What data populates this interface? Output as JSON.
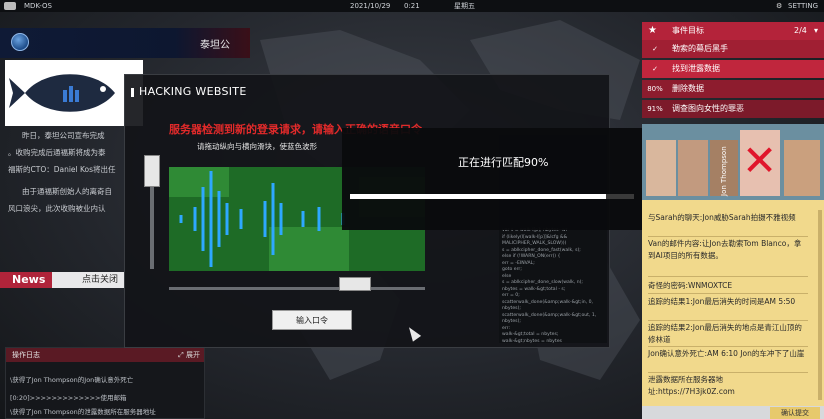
{
  "topbar": {
    "app": "MDK-OS",
    "date": "2021/10/29",
    "time": "0:21",
    "weekday": "星期五",
    "setting": "SETTING"
  },
  "news": {
    "title": "泰坦公",
    "paragraphs": [
      "昨日，泰坦公司宣布完成",
      "。收购完成后通福斯将成为泰",
      "福斯的CTO：Daniel Kos将出任",
      "由于通福斯创始人的离奇自",
      "风口浪尖，此次收购被业内认"
    ],
    "tag": "News",
    "tag2": "点击关闭"
  },
  "log": {
    "title": "操作日志",
    "expand": "展开",
    "lines": [
      "\\获得了Jon Thompson的Jon确认意外死亡",
      "[0:20]>>>>>>>>>>>>>使用邮箱",
      "\\获得了Jon Thompson的泄露数据所在服务器地址"
    ]
  },
  "objectives": {
    "title": "事件目标",
    "count": "2/4",
    "items": [
      {
        "mark": "✓",
        "label": "勒索的幕后黑手"
      },
      {
        "mark": "✓",
        "label": "找到泄露数据"
      },
      {
        "mark": "80%",
        "label": "删除数据"
      },
      {
        "mark": "91%",
        "label": "调查图向女性的罪恶"
      }
    ]
  },
  "photo_label": "Jon Thompson",
  "notes": [
    "与Sarah的聊天:Jon威胁Sarah拍摄不雅视频",
    "Van的邮件内容:让Jon去勒索Tom Blanco，拿到AI项目的所有数据。",
    "奇怪的密码:WNMOXTCE",
    "追踪的结果1:Jon最后消失的时间是AM 5:50",
    "追踪的结果2:Jon最后消失的地点是青江山顶的修林道",
    "Jon确认意外死亡:AM 6:10 Jon的车冲下了山崖",
    "泄露数据所在服务器地址:https://7H3jk0Z.com"
  ],
  "notes_btn": "确认提交",
  "hack": {
    "title": "HACKING WEBSITE",
    "warning": "服务器检测到新的登录请求，请输入正确的语音口令",
    "subtitle": "请拖动纵向与横向滑块，使蓝色波形",
    "input_button": "输入口令",
    "match_text": "正在进行匹配90%",
    "match_progress": 0.9
  },
  "code_lines": [
    "var s = walk-l[p]; nbytes--wr",
    "if (likely(l[walk-l[p]]&lcfg &&",
    "MALICIPHER_WALK_SLOW)))",
    "s = ablkcipher_done_fast(walk, s);",
    "else if (!WARN_ON(err)) {",
    "err = -EINVAL;",
    "goto err;",
    "else",
    "s = ablkcipher_done_slow(walk, n);",
    "nbytes = walk-&gt;total - s;",
    "err = 0;",
    "scatterwalk_done(&amp;walk-&gt;in, 0, nbytes);",
    "scatterwalk_done(&amp;walk-&gt;out, 1, nbytes);",
    "err:",
    "walk-&gt;total = nbytes;",
    "walk-&gt;nbytes = nbytes"
  ]
}
